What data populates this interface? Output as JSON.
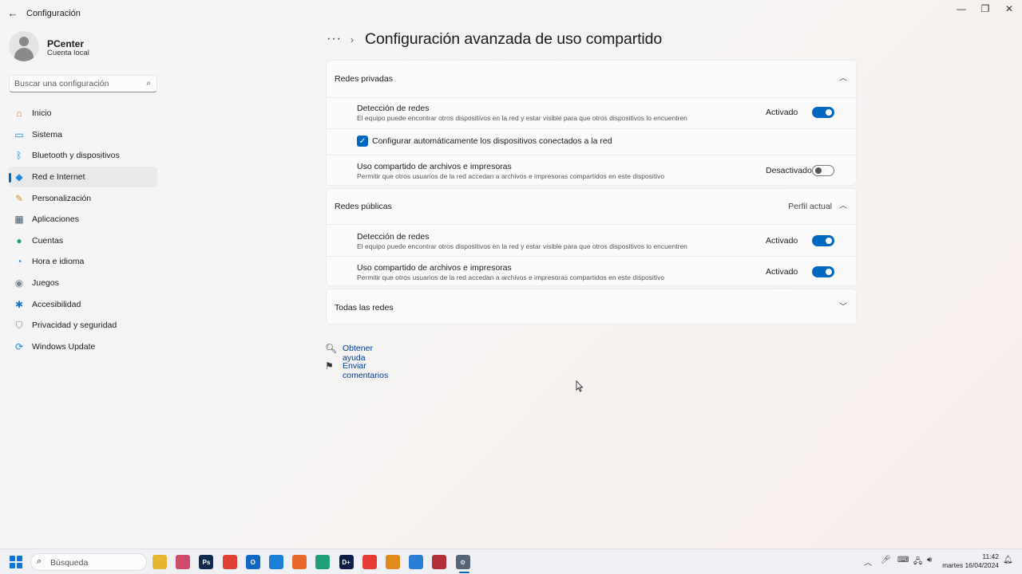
{
  "window": {
    "app_title": "Configuración",
    "back_glyph": "←",
    "minimize_glyph": "—",
    "maximize_glyph": "❐",
    "close_glyph": "✕"
  },
  "profile": {
    "name": "PCenter",
    "account_type": "Cuenta local"
  },
  "search": {
    "placeholder": "Buscar una configuración",
    "icon": "search-icon"
  },
  "nav": {
    "selected_index": 3,
    "items": [
      {
        "label": "Inicio",
        "icon": "home-icon",
        "color": "#d97b31"
      },
      {
        "label": "Sistema",
        "icon": "system-icon",
        "color": "#1a86d9"
      },
      {
        "label": "Bluetooth y dispositivos",
        "icon": "bluetooth-icon",
        "color": "#1a86d9"
      },
      {
        "label": "Red e Internet",
        "icon": "wifi-icon",
        "color": "#1a86d9"
      },
      {
        "label": "Personalización",
        "icon": "brush-icon",
        "color": "#d98b2b"
      },
      {
        "label": "Aplicaciones",
        "icon": "apps-icon",
        "color": "#4a5a73"
      },
      {
        "label": "Cuentas",
        "icon": "account-icon",
        "color": "#1fa37a"
      },
      {
        "label": "Hora e idioma",
        "icon": "globe-clock-icon",
        "color": "#1a86d9"
      },
      {
        "label": "Juegos",
        "icon": "gamepad-icon",
        "color": "#7a8596"
      },
      {
        "label": "Accesibilidad",
        "icon": "accessibility-icon",
        "color": "#1a78c2"
      },
      {
        "label": "Privacidad y seguridad",
        "icon": "shield-icon",
        "color": "#7a8596"
      },
      {
        "label": "Windows Update",
        "icon": "update-icon",
        "color": "#1a86d9"
      }
    ]
  },
  "main": {
    "breadcrumb_more": "···",
    "breadcrumb_sep": "›",
    "page_title": "Configuración avanzada de uso compartido",
    "private": {
      "title": "Redes privadas",
      "chevron": "︿",
      "discovery_title": "Detección de redes",
      "discovery_desc": "El equipo puede encontrar otros dispositivos en la red y estar visible para que otros dispositivos lo encuentren",
      "discovery_state": "Activado",
      "discovery_on": true,
      "auto_config_label": "Configurar automáticamente los dispositivos conectados a la red",
      "auto_config_checked": true,
      "sharing_title": "Uso compartido de archivos e impresoras",
      "sharing_desc": "Permitir que otros usuarios de la red accedan a archivos e impresoras compartidos en este dispositivo",
      "sharing_state": "Desactivado",
      "sharing_on": false
    },
    "public": {
      "title": "Redes públicas",
      "profile_label": "Perfil actual",
      "chevron": "︿",
      "discovery_title": "Detección de redes",
      "discovery_desc": "El equipo puede encontrar otros dispositivos en la red y estar visible para que otros dispositivos lo encuentren",
      "discovery_state": "Activado",
      "discovery_on": true,
      "sharing_title": "Uso compartido de archivos e impresoras",
      "sharing_desc": "Permitir que otros usuarios de la red accedan a archivos e impresoras compartidos en este dispositivo",
      "sharing_state": "Activado",
      "sharing_on": true
    },
    "all": {
      "title": "Todas las redes",
      "chevron": "﹀"
    },
    "help_link": "Obtener ayuda",
    "feedback_link": "Enviar comentarios"
  },
  "accent_color": "#0067c0",
  "taskbar": {
    "search_placeholder": "Búsqueda",
    "apps": [
      {
        "name": "file-explorer-icon",
        "color": "#e8b530",
        "glyph": ""
      },
      {
        "name": "pinwheel-app-icon",
        "color": "#d04a6b",
        "glyph": ""
      },
      {
        "name": "photoshop-icon",
        "color": "#0f2a4f",
        "glyph": "Ps"
      },
      {
        "name": "chrome-icon",
        "color": "#de4133",
        "glyph": ""
      },
      {
        "name": "outlook-icon",
        "color": "#0f68c3",
        "glyph": "O"
      },
      {
        "name": "vscode-icon",
        "color": "#1a7fd4",
        "glyph": ""
      },
      {
        "name": "firefox-icon",
        "color": "#e8692a",
        "glyph": ""
      },
      {
        "name": "edge-icon",
        "color": "#1e9e7a",
        "glyph": ""
      },
      {
        "name": "disney-plus-icon",
        "color": "#0c1e47",
        "glyph": "D+"
      },
      {
        "name": "anydesk-icon",
        "color": "#e53b35",
        "glyph": ""
      },
      {
        "name": "app-orange-icon",
        "color": "#e08a1c",
        "glyph": ""
      },
      {
        "name": "app-blue-icon",
        "color": "#2a7fd4",
        "glyph": ""
      },
      {
        "name": "app-photo-icon",
        "color": "#b3303a",
        "glyph": ""
      },
      {
        "name": "settings-gear-icon",
        "color": "#566477",
        "glyph": "⚙"
      }
    ],
    "time": "11:42",
    "date": "martes 16/04/2024"
  }
}
